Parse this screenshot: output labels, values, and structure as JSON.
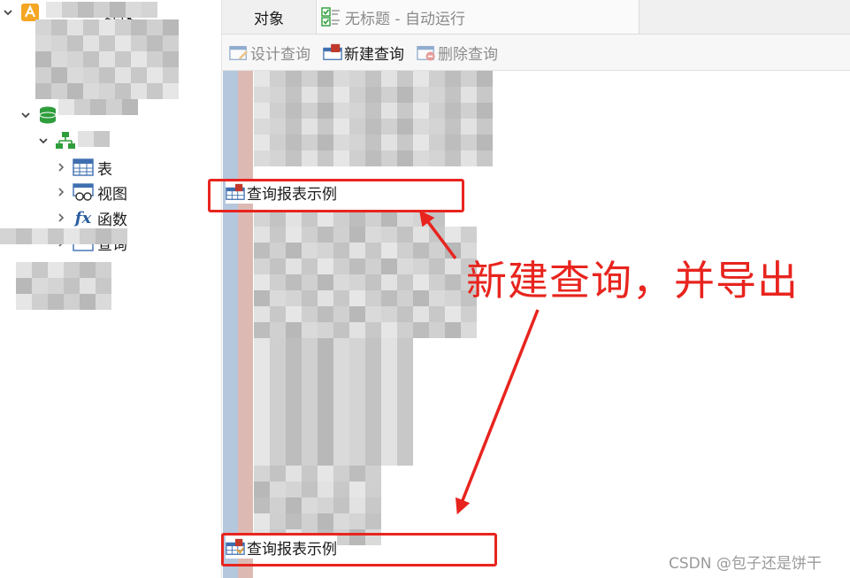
{
  "nav": {
    "connection_label": "连接",
    "items": [
      {
        "label": "表",
        "icon": "table-icon"
      },
      {
        "label": "视图",
        "icon": "view-icon"
      },
      {
        "label": "函数",
        "icon": "function-icon",
        "glyph": "fx"
      },
      {
        "label": "查询",
        "icon": "query-icon"
      }
    ]
  },
  "tabs": {
    "objects": "对象",
    "query_tab": "无标题 - 自动运行"
  },
  "toolbar": {
    "design_query": "设计查询",
    "new_query": "新建查询",
    "delete_query": "删除查询"
  },
  "list": {
    "item_top": "查询报表示例",
    "item_bottom": "查询报表示例"
  },
  "annotation": {
    "callout": "新建查询，并导出"
  },
  "watermark": "CSDN @包子还是饼干",
  "colors": {
    "annotation_red": "#e8241e",
    "db_green": "#2e9d3c",
    "table_blue": "#3f6fb0",
    "query_red": "#c0392b"
  }
}
